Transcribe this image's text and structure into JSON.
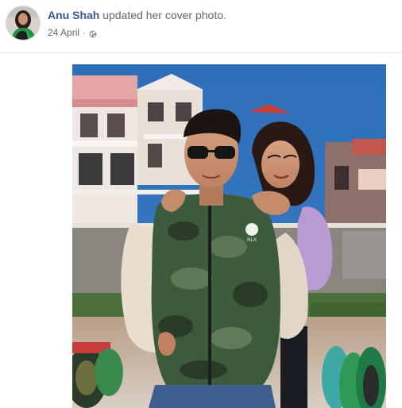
{
  "post": {
    "author_name": "Anu Shah",
    "action_text": " updated her cover photo.",
    "date": "24 April",
    "separator": "·",
    "privacy_icon": "globe-icon"
  },
  "photo": {
    "logo_text": "RLX"
  }
}
